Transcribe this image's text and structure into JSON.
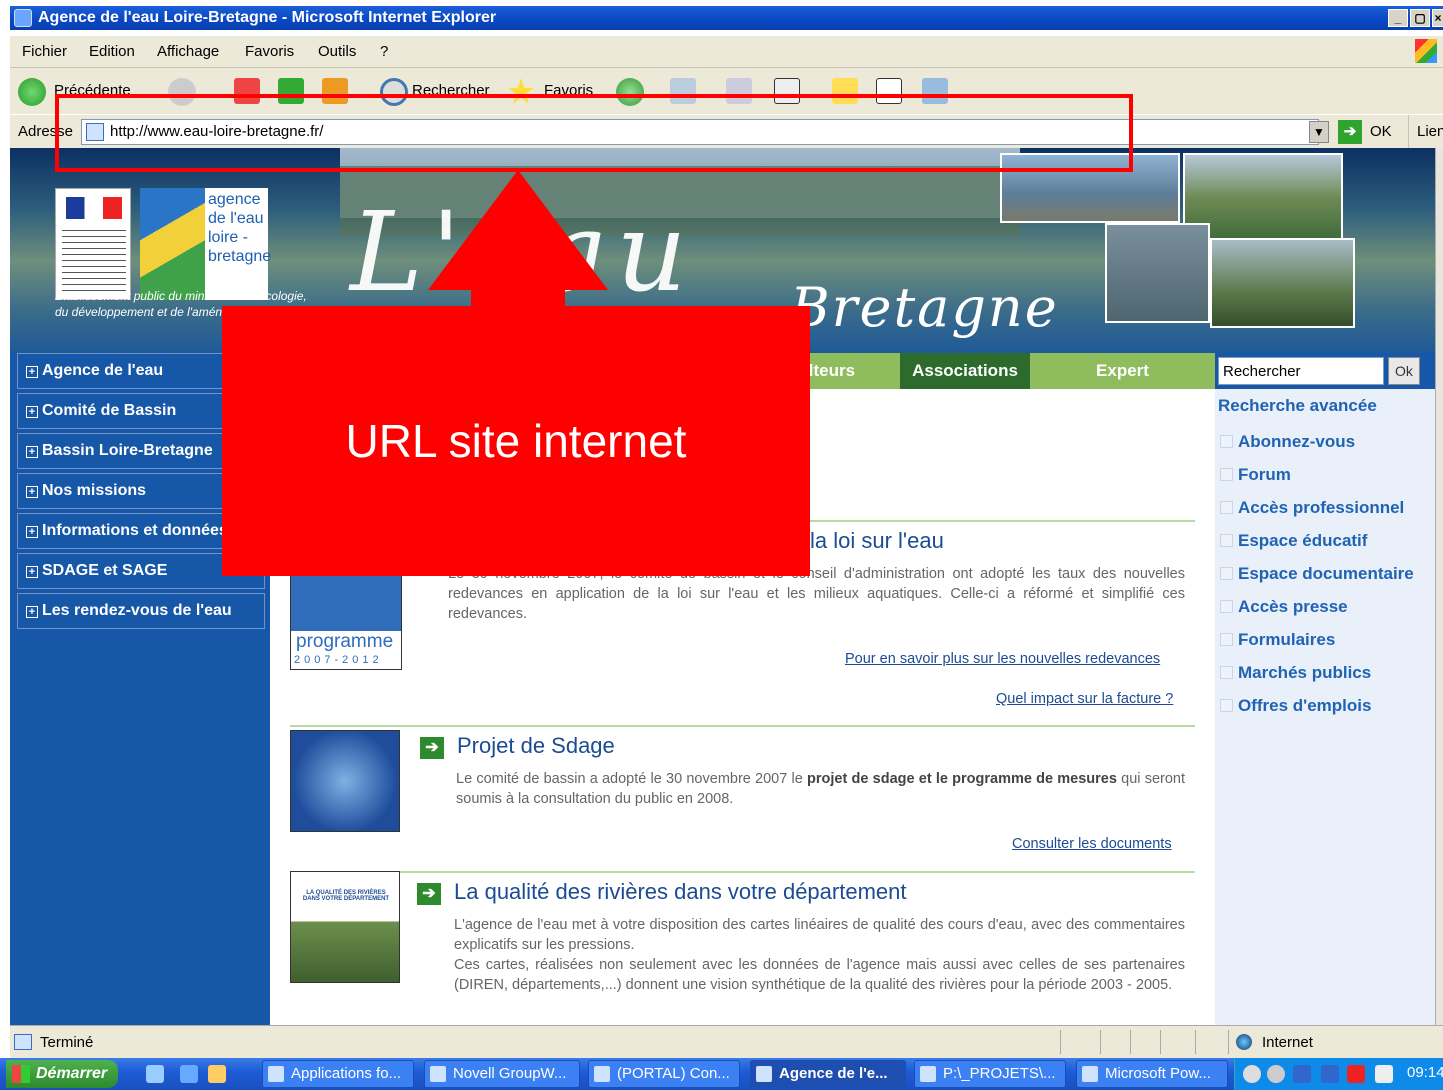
{
  "window": {
    "title": "Agence de l'eau Loire-Bretagne - Microsoft Internet Explorer"
  },
  "menu": [
    "Fichier",
    "Edition",
    "Affichage",
    "Favoris",
    "Outils",
    "?"
  ],
  "toolbar": {
    "back_label": "Précédente",
    "search_label": "Rechercher",
    "favorites_label": "Favoris"
  },
  "address": {
    "label": "Adresse",
    "url": "http://www.eau-loire-bretagne.fr/",
    "go_label": "OK",
    "links_label": "Liens"
  },
  "banner": {
    "logo_name": [
      "agence",
      "de l'eau",
      "loire -",
      "bretagne"
    ],
    "logo_sub": [
      "Établissement public du ministère de l'écologie,",
      "du développement et de l'aménagement durables"
    ],
    "title": "L'eau",
    "subtitle": "Bretagne"
  },
  "nav": [
    "Agence de l'eau",
    "Comité de Bassin",
    "Bassin Loire-Bretagne",
    "Nos missions",
    "Informations et données",
    "SDAGE et SAGE",
    "Les rendez-vous de l'eau"
  ],
  "tabs": [
    "Agriculteurs",
    "Associations",
    "Expert"
  ],
  "articles": [
    {
      "title": "la loi sur l'eau",
      "text": "Le 30 novembre 2007, le comité de bassin et le conseil d'administration ont adopté les taux des nouvelles redevances en application de la loi sur l'eau et les milieux aquatiques. Celle-ci a réformé et simplifié ces redevances.",
      "links": [
        "Pour en savoir plus sur les nouvelles redevances",
        "Quel impact sur la facture ?"
      ],
      "thumb_text": "programme",
      "thumb_years": "2007-2012"
    },
    {
      "title": "Projet de Sdage",
      "text_pre": "Le comité de bassin a adopté le 30 novembre 2007 le ",
      "text_bold": "projet de sdage et le programme de mesures",
      "text_post": " qui seront soumis à la consultation du public en 2008.",
      "links": [
        "Consulter les documents"
      ]
    },
    {
      "title": "La qualité des rivières dans votre département",
      "text": "L'agence de l'eau met à votre disposition des cartes linéaires de qualité des cours d'eau, avec des commentaires explicatifs sur les pressions.",
      "text2": "Ces cartes, réalisées non seulement avec les données de l'agence mais aussi avec celles de ses partenaires (DIREN, départements,...) donnent une vision synthétique de la qualité des rivières pour la période 2003 - 2005.",
      "thumb_text": "LA QUALITÉ DES RIVIÈRES DANS VOTRE DÉPARTEMENT"
    }
  ],
  "sidebar": {
    "search_placeholder": "Rechercher",
    "search_value": "Rechercher",
    "search_ok": "Ok",
    "advanced": "Recherche avancée",
    "links": [
      "Abonnez-vous",
      "Forum",
      "Accès professionnel",
      "Espace éducatif",
      "Espace documentaire",
      "Accès presse",
      "Formulaires",
      "Marchés publics",
      "Offres d'emplois"
    ]
  },
  "annotation": {
    "label": "URL site internet",
    "color": "#ff0000"
  },
  "status": {
    "text": "Terminé",
    "zone": "Internet"
  },
  "taskbar": {
    "start": "Démarrer",
    "tasks": [
      "Applications fo...",
      "Novell GroupW...",
      "(PORTAL) Con...",
      "Agence de l'e...",
      "P:\\_PROJETS\\...",
      "Microsoft Pow..."
    ],
    "clock": "09:14"
  },
  "colors": {
    "nav_blue": "#1657a8",
    "tab_green": "#8fbc5c",
    "link_blue": "#1b4c93",
    "sidebar_bg": "#e9f0f9"
  }
}
